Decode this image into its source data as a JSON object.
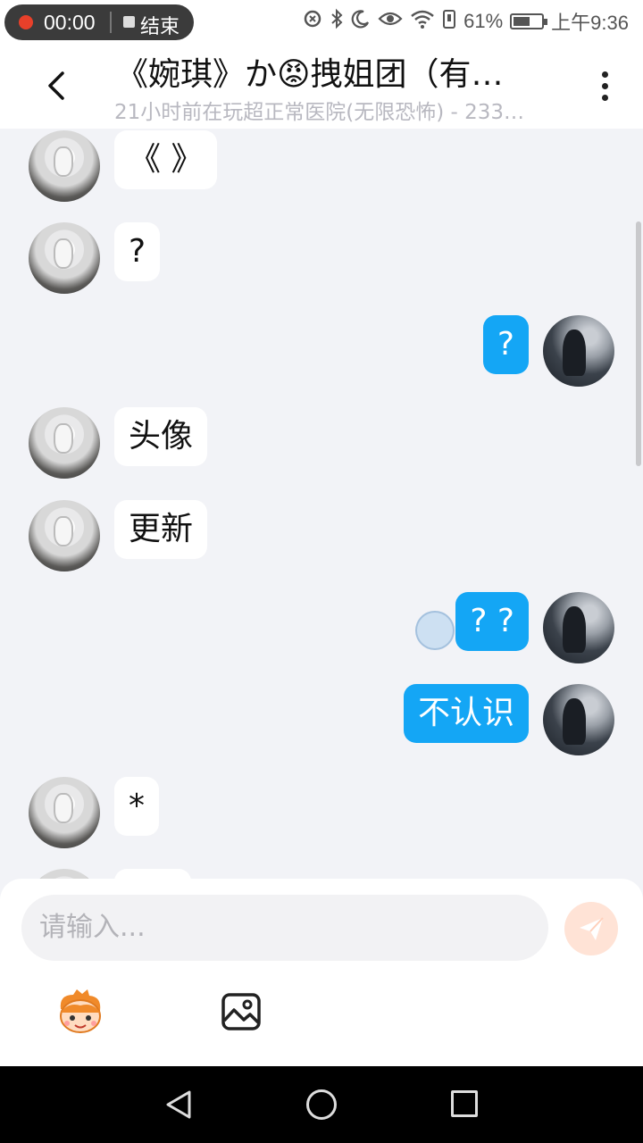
{
  "status_bar": {
    "recording_time": "00:00",
    "recording_end_label": "结束",
    "battery": "61%",
    "battery_level": 0.61,
    "time": "上午9:36"
  },
  "header": {
    "title": "《婉琪》か😡拽姐团（有…",
    "subtitle": "21小时前在玩超正常医院(无限恐怖) - 233…"
  },
  "messages": [
    {
      "side": "other",
      "text": "《 》"
    },
    {
      "side": "other",
      "text": "?"
    },
    {
      "side": "me",
      "text": "?"
    },
    {
      "side": "other",
      "text": "头像"
    },
    {
      "side": "other",
      "text": "更新"
    },
    {
      "side": "me",
      "text": "? ?"
    },
    {
      "side": "me",
      "text": "不认识"
    },
    {
      "side": "other",
      "text": "*"
    }
  ],
  "input": {
    "placeholder": "请输入..."
  },
  "colors": {
    "my_bubble": "#14a6f5",
    "send_button": "#ffe3d6"
  }
}
